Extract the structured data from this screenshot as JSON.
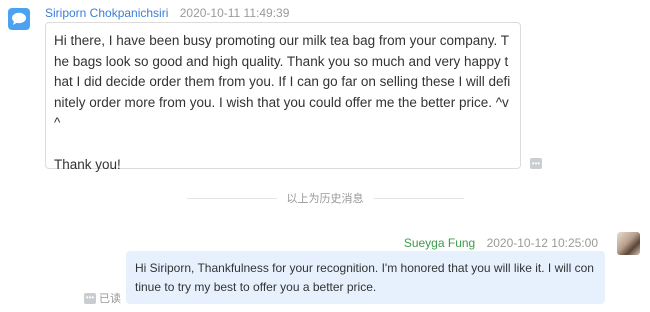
{
  "incoming": {
    "sender": "Siriporn Chokpanichsiri",
    "timestamp": "2020-10-11 11:49:39",
    "message": "Hi there, I have been busy promoting our milk tea bag from your company. The bags look so good and high quality. Thank you so much and very happy that I did decide order them from you. If I can go far on selling these I will definitely order more from you. I wish that you could offer me the better price. ^v^\n\nThank you!"
  },
  "divider": {
    "label": "以上为历史消息"
  },
  "outgoing": {
    "sender": "Sueyga Fung",
    "timestamp": "2020-10-12 10:25:00",
    "message": "Hi Siriporn, Thankfulness for your recognition. I'm honored that you will like it. I will continue to try my best to offer you a better price.",
    "read_status": "已读"
  },
  "colors": {
    "incoming_name": "#3b7dd8",
    "outgoing_name": "#3c9c4a",
    "outgoing_bubble": "#e7f1fd",
    "avatar_left": "#4aa3f0"
  },
  "icons": {
    "left_avatar": "chat-bubble-avatar-icon",
    "more": "more-options-icon"
  }
}
